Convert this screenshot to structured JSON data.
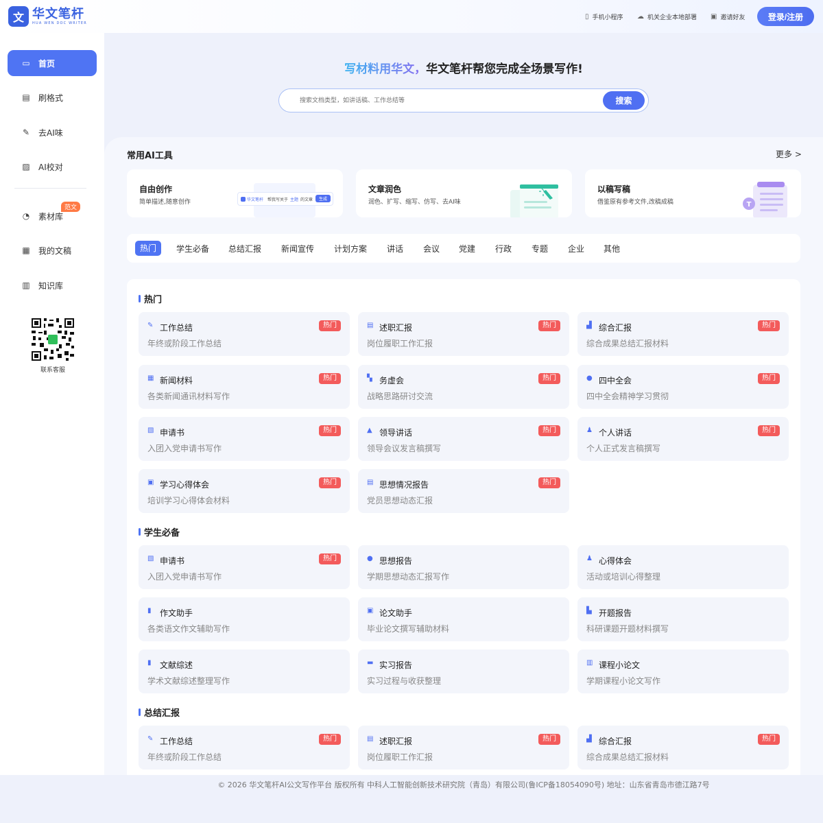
{
  "header": {
    "logo_mark": "文",
    "logo_cn": "华文笔杆",
    "logo_en": "HUA WEN DOC WRITER",
    "links": [
      {
        "label": "手机小程序",
        "icon": "phone-icon"
      },
      {
        "label": "机关企业本地部署",
        "icon": "cloud-icon"
      },
      {
        "label": "邀请好友",
        "icon": "gift-icon"
      }
    ],
    "login_label": "登录/注册"
  },
  "sidebar": {
    "items": [
      {
        "label": "首页",
        "icon": "folder-icon",
        "active": true
      },
      {
        "label": "刷格式",
        "icon": "format-icon"
      },
      {
        "label": "去AI味",
        "icon": "pen-icon"
      },
      {
        "label": "AI校对",
        "icon": "proofread-icon"
      },
      {
        "label": "素材库",
        "icon": "material-icon"
      },
      {
        "label": "我的文稿",
        "icon": "document-icon"
      },
      {
        "label": "知识库",
        "icon": "library-icon"
      }
    ],
    "new_badge": "范文",
    "qr_label": "联系客服"
  },
  "hero": {
    "accent": "写材料用华文，",
    "rest": "华文笔杆帮您完成全场景写作!"
  },
  "search": {
    "placeholder": "搜索文档类型，如讲话稿、工作总结等",
    "button_label": "搜索"
  },
  "tools": {
    "title": "常用AI工具",
    "more": "更多 >",
    "cards": [
      {
        "name": "自由创作",
        "desc": "简单描述,随意创作",
        "illus_text": "帮我写关于",
        "illus_topic": "主题",
        "illus_suffix": "的文章",
        "illus_btn": "生成",
        "illus_brand": "华文笔杆"
      },
      {
        "name": "文章润色",
        "desc": "润色、扩写、缩写、仿写、去AI味"
      },
      {
        "name": "以稿写稿",
        "desc": "借鉴原有参考文件,改稿成稿"
      }
    ]
  },
  "tabs": [
    "热门",
    "学生必备",
    "总结汇报",
    "新闻宣传",
    "计划方案",
    "讲话",
    "会议",
    "党建",
    "行政",
    "专题",
    "企业",
    "其他"
  ],
  "hot_label": "热门",
  "sections": [
    {
      "title": "热门",
      "items": [
        {
          "name": "工作总结",
          "desc": "年终或阶段工作总结",
          "hot": true
        },
        {
          "name": "述职汇报",
          "desc": "岗位履职工作汇报",
          "hot": true
        },
        {
          "name": "综合汇报",
          "desc": "综合成果总结汇报材料",
          "hot": true
        },
        {
          "name": "新闻材料",
          "desc": "各类新闻通讯材料写作",
          "hot": true
        },
        {
          "name": "务虚会",
          "desc": "战略思路研讨交流",
          "hot": true
        },
        {
          "name": "四中全会",
          "desc": "四中全会精神学习贯彻",
          "hot": true
        },
        {
          "name": "申请书",
          "desc": "入团入党申请书写作",
          "hot": true
        },
        {
          "name": "领导讲话",
          "desc": "领导会议发言稿撰写",
          "hot": true
        },
        {
          "name": "个人讲话",
          "desc": "个人正式发言稿撰写",
          "hot": true
        },
        {
          "name": "学习心得体会",
          "desc": "培训学习心得体会材料",
          "hot": true
        },
        {
          "name": "思想情况报告",
          "desc": "党员思想动态汇报",
          "hot": true
        }
      ]
    },
    {
      "title": "学生必备",
      "items": [
        {
          "name": "申请书",
          "desc": "入团入党申请书写作",
          "hot": true
        },
        {
          "name": "思想报告",
          "desc": "学期思想动态汇报写作",
          "hot": false
        },
        {
          "name": "心得体会",
          "desc": "活动或培训心得整理",
          "hot": false
        },
        {
          "name": "作文助手",
          "desc": "各类语文作文辅助写作",
          "hot": false
        },
        {
          "name": "论文助手",
          "desc": "毕业论文撰写辅助材料",
          "hot": false
        },
        {
          "name": "开题报告",
          "desc": "科研课题开题材料撰写",
          "hot": false
        },
        {
          "name": "文献综述",
          "desc": "学术文献综述整理写作",
          "hot": false
        },
        {
          "name": "实习报告",
          "desc": "实习过程与收获整理",
          "hot": false
        },
        {
          "name": "课程小论文",
          "desc": "学期课程小论文写作",
          "hot": false
        }
      ]
    },
    {
      "title": "总结汇报",
      "items": [
        {
          "name": "工作总结",
          "desc": "年终或阶段工作总结",
          "hot": true
        },
        {
          "name": "述职汇报",
          "desc": "岗位履职工作汇报",
          "hot": true
        },
        {
          "name": "综合汇报",
          "desc": "综合成果总结汇报材料",
          "hot": true
        }
      ]
    }
  ],
  "footer": "© 2026 华文笔杆AI公文写作平台 版权所有 中科人工智能创新技术研究院（青岛）有限公司(鲁ICP备18054090号) 地址：山东省青岛市德江路7号",
  "colors": {
    "primary": "#4f74f3",
    "hot": "#f35b5b",
    "new_badge": "#ff7a45"
  }
}
